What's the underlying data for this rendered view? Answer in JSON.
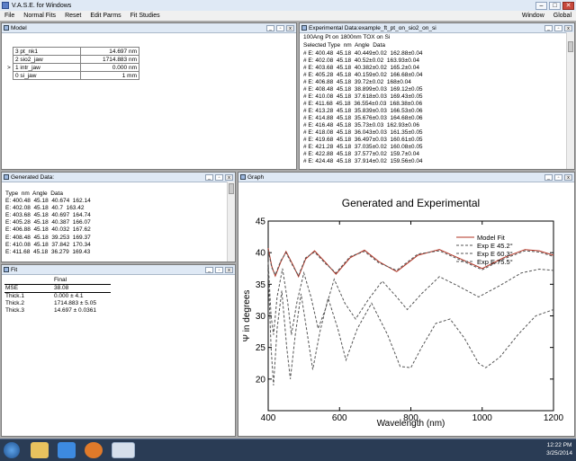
{
  "app": {
    "title": "V.A.S.E. for Windows"
  },
  "menu": {
    "items": [
      "File",
      "Normal Fits",
      "Reset",
      "Edit Parms",
      "Fit Studies"
    ],
    "right_items": [
      "Window",
      "Global"
    ]
  },
  "model_window": {
    "title": "Model",
    "rows": [
      {
        "marker": "",
        "name": "3 pt_nk1",
        "value": "14.697 nm"
      },
      {
        "marker": "",
        "name": "2 sio2_jaw",
        "value": "1714.883 nm"
      },
      {
        "marker": ">",
        "name": "1 intr_jaw",
        "value": "0.000 nm"
      },
      {
        "marker": "",
        "name": "0 si_jaw",
        "value": "1 mm"
      }
    ]
  },
  "exp_window": {
    "title": "Experimental Data:example_ft_pt_on_sio2_on_si",
    "line1": "100Ang Pt on 1800nm TOX on Si",
    "header": "Selected Type  nm  Angle  Data",
    "rows": [
      "# E: 400.48  45.18  40.449±0.02  162.88±0.04",
      "# E: 402.08  45.18  40.52±0.02  163.93±0.04",
      "# E: 403.68  45.18  40.382±0.02  165.2±0.04",
      "# E: 405.28  45.18  40.159±0.02  166.68±0.04",
      "# E: 406.88  45.18  39.72±0.02  168±0.04",
      "# E: 408.48  45.18  38.899±0.03  169.12±0.05",
      "# E: 410.08  45.18  37.618±0.03  169.43±0.05",
      "# E: 411.68  45.18  36.554±0.03  168.38±0.06",
      "# E: 413.28  45.18  35.839±0.03  166.53±0.06",
      "# E: 414.88  45.18  35.676±0.03  164.68±0.06",
      "# E: 416.48  45.18  35.73±0.03  162.93±0.06",
      "# E: 418.08  45.18  36.043±0.03  161.35±0.05",
      "# E: 419.68  45.18  36.497±0.03  160.61±0.05",
      "# E: 421.28  45.18  37.035±0.02  160.08±0.05",
      "# E: 422.88  45.18  37.577±0.02  159.7±0.04",
      "# E: 424.48  45.18  37.914±0.02  159.56±0.04"
    ]
  },
  "gen_window": {
    "title": "Generated Data:",
    "header": "Type  nm  Angle  Data",
    "rows": [
      "E: 400.48  45.18  40.674  162.14",
      "E: 402.08  45.18  40.7  163.42",
      "E: 403.68  45.18  40.697  164.74",
      "E: 405.28  45.18  40.387  166.07",
      "E: 406.88  45.18  40.032  167.62",
      "E: 408.48  45.18  39.253  169.37",
      "E: 410.08  45.18  37.842  170.34",
      "E: 411.68  45.18  36.279  169.43"
    ]
  },
  "fit_window": {
    "title": "Fit",
    "col_header": "Final",
    "rows": [
      {
        "name": "MSE",
        "value": "38.08"
      },
      {
        "name": "Thick.1",
        "value": "0.000 ± 4.1"
      },
      {
        "name": "Thick.2",
        "value": "1714.883 ± 5.05"
      },
      {
        "name": "Thick.3",
        "value": "14.697 ± 0.0361"
      }
    ]
  },
  "graph_window": {
    "title": "Graph"
  },
  "chart_data": {
    "type": "line",
    "title": "Generated and Experimental",
    "xlabel": "Wavelength (nm)",
    "ylabel": "Ψ in degrees",
    "xlim": [
      400,
      1200
    ],
    "ylim": [
      15,
      45
    ],
    "xticks": [
      400,
      600,
      800,
      1000,
      1200
    ],
    "yticks": [
      20,
      25,
      30,
      35,
      40,
      45
    ],
    "grid": false,
    "legend_position": "top-right",
    "series": [
      {
        "name": "Model Fit",
        "color": "#b03020",
        "style": "solid",
        "points": [
          [
            400,
            40.7
          ],
          [
            410,
            37.8
          ],
          [
            420,
            36.3
          ],
          [
            435,
            38.5
          ],
          [
            450,
            40.2
          ],
          [
            470,
            38
          ],
          [
            485,
            36.2
          ],
          [
            505,
            39
          ],
          [
            530,
            40.3
          ],
          [
            560,
            38.5
          ],
          [
            590,
            36.6
          ],
          [
            630,
            39.2
          ],
          [
            670,
            40.4
          ],
          [
            710,
            38.6
          ],
          [
            760,
            37.0
          ],
          [
            820,
            39.6
          ],
          [
            880,
            40.5
          ],
          [
            940,
            39
          ],
          [
            1000,
            37.5
          ],
          [
            1060,
            39.2
          ],
          [
            1120,
            40.5
          ],
          [
            1160,
            40.3
          ],
          [
            1200,
            39.6
          ]
        ]
      },
      {
        "name": "Exp E 45.2°",
        "color": "#555555",
        "style": "dashed",
        "points": [
          [
            400,
            40.4
          ],
          [
            410,
            37.6
          ],
          [
            420,
            36.5
          ],
          [
            435,
            38.7
          ],
          [
            450,
            40.0
          ],
          [
            470,
            37.8
          ],
          [
            485,
            36.4
          ],
          [
            505,
            39.2
          ],
          [
            530,
            40.1
          ],
          [
            560,
            38.3
          ],
          [
            590,
            36.8
          ],
          [
            630,
            39.4
          ],
          [
            670,
            40.2
          ],
          [
            710,
            38.4
          ],
          [
            760,
            37.2
          ],
          [
            820,
            39.8
          ],
          [
            880,
            40.3
          ],
          [
            940,
            38.8
          ],
          [
            1000,
            37.3
          ],
          [
            1060,
            39.0
          ],
          [
            1120,
            40.3
          ],
          [
            1160,
            40.1
          ],
          [
            1200,
            39.4
          ]
        ]
      },
      {
        "name": "Exp E 60.3°",
        "color": "#555555",
        "style": "dashed",
        "points": [
          [
            400,
            38.5
          ],
          [
            408,
            30
          ],
          [
            415,
            27
          ],
          [
            425,
            33
          ],
          [
            440,
            37.5
          ],
          [
            455,
            32
          ],
          [
            465,
            27
          ],
          [
            480,
            32
          ],
          [
            500,
            36.8
          ],
          [
            520,
            33
          ],
          [
            540,
            28
          ],
          [
            560,
            31
          ],
          [
            585,
            35.8
          ],
          [
            615,
            32
          ],
          [
            645,
            29.5
          ],
          [
            680,
            32.5
          ],
          [
            720,
            35.5
          ],
          [
            760,
            33
          ],
          [
            790,
            31
          ],
          [
            830,
            33.5
          ],
          [
            880,
            36.2
          ],
          [
            930,
            34.8
          ],
          [
            990,
            33
          ],
          [
            1050,
            34.8
          ],
          [
            1110,
            36.8
          ],
          [
            1160,
            37.4
          ],
          [
            1200,
            37.2
          ]
        ]
      },
      {
        "name": "Exp E 75.5°",
        "color": "#555555",
        "style": "dashed",
        "points": [
          [
            400,
            37
          ],
          [
            408,
            25
          ],
          [
            415,
            19
          ],
          [
            425,
            28
          ],
          [
            438,
            34
          ],
          [
            452,
            25
          ],
          [
            462,
            20
          ],
          [
            476,
            27
          ],
          [
            492,
            33.5
          ],
          [
            510,
            27
          ],
          [
            525,
            21.5
          ],
          [
            545,
            27.5
          ],
          [
            568,
            32.8
          ],
          [
            595,
            28
          ],
          [
            618,
            23
          ],
          [
            650,
            28
          ],
          [
            690,
            32
          ],
          [
            735,
            27
          ],
          [
            770,
            22
          ],
          [
            800,
            21.8
          ],
          [
            830,
            25
          ],
          [
            870,
            28.8
          ],
          [
            910,
            29.5
          ],
          [
            950,
            26.5
          ],
          [
            990,
            22.5
          ],
          [
            1010,
            21.8
          ],
          [
            1050,
            23.5
          ],
          [
            1100,
            27
          ],
          [
            1150,
            30
          ],
          [
            1200,
            31
          ]
        ]
      }
    ]
  },
  "taskbar": {
    "time": "12:22 PM",
    "date": "3/25/2014"
  }
}
